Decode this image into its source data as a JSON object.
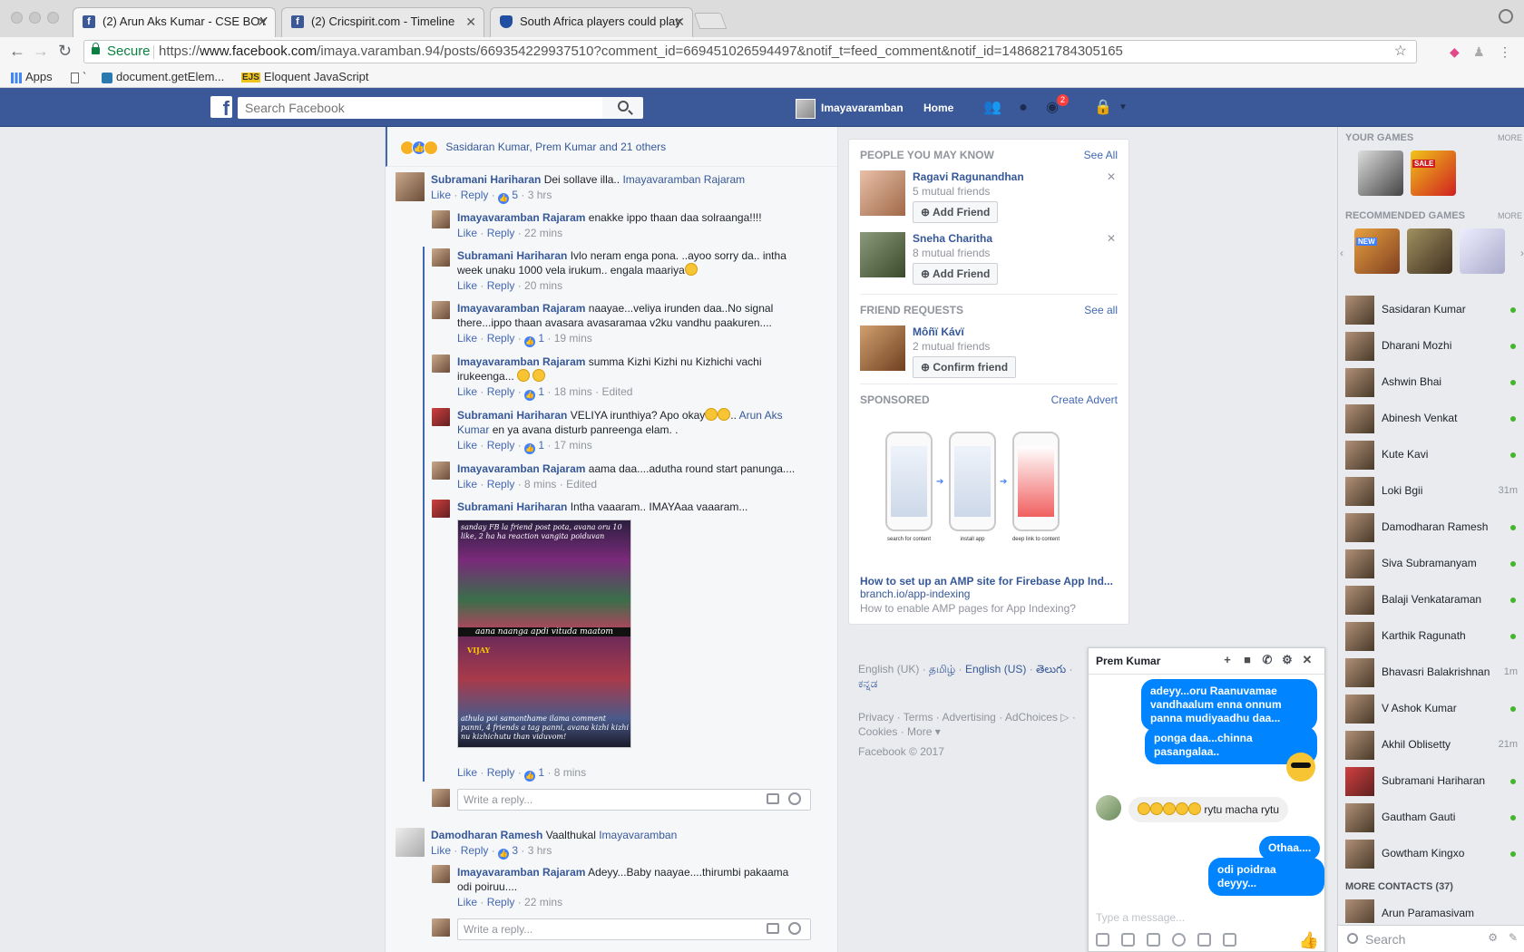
{
  "browser": {
    "tabs": [
      {
        "title": "(2) Arun Aks Kumar - CSE BOY",
        "icon": "facebook-icon"
      },
      {
        "title": "(2) Cricspirit.com - Timeline",
        "icon": "facebook-icon"
      },
      {
        "title": "South Africa players could play",
        "icon": "shield-icon"
      }
    ],
    "secure_label": "Secure",
    "url_scheme": "https://",
    "url_host": "www.facebook.com",
    "url_path": "/imaya.varamban.94/posts/669354229937510?comment_id=669451026594497&notif_t=feed_comment&notif_id=1486821784305165",
    "bookmarks": [
      "Apps",
      "`",
      "document.getElem...",
      "Eloquent JavaScript"
    ],
    "bookmark_ejs": "EJS"
  },
  "fb": {
    "logo": "f",
    "search_placeholder": "Search Facebook",
    "user_name": "Imayavaramban",
    "home_label": "Home",
    "notif_count": "2"
  },
  "post": {
    "reactions_text": "Sasidaran Kumar, Prem Kumar and 21 others",
    "comments": [
      {
        "name": "Subramani Hariharan",
        "text": "Dei sollave illa..",
        "tag": "Imayavaramban Rajaram",
        "like": "Like",
        "reply": "Reply",
        "likes": "5",
        "time": "3 hrs"
      },
      {
        "name": "Imayavaramban Rajaram",
        "text": "enakke ippo thaan daa solraanga!!!!",
        "like": "Like",
        "reply": "Reply",
        "time": "22 mins"
      },
      {
        "name": "Subramani Hariharan",
        "text": "Ivlo neram enga pona. ..ayoo sorry da.. intha",
        "text2": "week unaku 1000 vela irukum.. engala maariya",
        "like": "Like",
        "reply": "Reply",
        "time": "20 mins"
      },
      {
        "name": "Imayavaramban Rajaram",
        "text": "naayae...veliya irunden daa..No signal",
        "text2": "there...ippo thaan avasara avasaramaa v2ku vandhu paakuren....",
        "like": "Like",
        "reply": "Reply",
        "likes": "1",
        "time": "19 mins"
      },
      {
        "name": "Imayavaramban Rajaram",
        "text": "summa Kizhi Kizhi nu Kizhichi vachi",
        "text2": "irukeenga...",
        "like": "Like",
        "reply": "Reply",
        "likes": "1",
        "time": "18 mins",
        "edited": "Edited"
      },
      {
        "name": "Subramani Hariharan",
        "text": "VELIYA irunthiya? Apo okay",
        "tag": "Arun Aks",
        "tag2": "Kumar",
        "text2": "en ya avana disturb panreenga elam. .",
        "like": "Like",
        "reply": "Reply",
        "likes": "1",
        "time": "17 mins"
      },
      {
        "name": "Imayavaramban Rajaram",
        "text": "aama daa....adutha round start panunga....",
        "like": "Like",
        "reply": "Reply",
        "time": "8 mins",
        "edited": "Edited"
      },
      {
        "name": "Subramani Hariharan",
        "text": "Intha vaaaram.. IMAYAaa vaaaram...",
        "like": "Like",
        "reply": "Reply",
        "likes": "1",
        "time": "8 mins"
      }
    ],
    "meme": {
      "cap_top": "sanday FB la friend post pota, avana oru 10 like, 2 ha ha reaction vangita poiduvan",
      "cap_mid": "aana naanga apdi vituda maatom",
      "cap_bot": "athula poi samanthame ilama comment panni, 4 friends a tag panni, avana kizhi kizhi nu kizhichutu than viduvom!",
      "logo": "VIJAY"
    },
    "reply_placeholder": "Write a reply...",
    "comment2": {
      "name": "Damodharan Ramesh",
      "text": "Vaalthukal",
      "tag": "Imayavaramban",
      "like": "Like",
      "reply": "Reply",
      "likes": "3",
      "time": "3 hrs"
    },
    "reply2": {
      "name": "Imayavaramban Rajaram",
      "text": "Adeyy...Baby naayae....thirumbi pakaama",
      "text2": "odi poiruu....",
      "like": "Like",
      "reply": "Reply",
      "time": "22 mins"
    }
  },
  "right": {
    "pymk_title": "PEOPLE YOU MAY KNOW",
    "pymk_see_all": "See All",
    "pymk": [
      {
        "name": "Ragavi Ragunandhan",
        "mutual": "5 mutual friends",
        "button": "Add Friend"
      },
      {
        "name": "Sneha Charitha",
        "mutual": "8 mutual friends",
        "button": "Add Friend"
      }
    ],
    "fr_title": "FRIEND REQUESTS",
    "fr_see_all": "See all",
    "fr": {
      "name": "Môñï Kávï",
      "mutual": "2 mutual friends",
      "button": "Confirm friend"
    },
    "sponsored_title": "SPONSORED",
    "create_advert": "Create Advert",
    "phone_labels": [
      "search for content",
      "install app",
      "deep link to content"
    ],
    "ad_title": "How to set up an AMP site for Firebase App Ind...",
    "ad_url": "branch.io/app-indexing",
    "ad_desc": "How to enable AMP pages for App Indexing?",
    "languages": [
      "English (UK)",
      "தமிழ்",
      "English (US)",
      "తెలుగు",
      "ಕನ್ನಡ"
    ],
    "footer_links": [
      "Privacy",
      "Terms",
      "Advertising",
      "AdChoices",
      "Cookies",
      "More"
    ],
    "copyright": "Facebook © 2017"
  },
  "chat": {
    "name": "Prem Kumar",
    "messages_out": [
      "adeyy...oru Raanuvamae vandhaalum enna onnum panna mudiyaadhu daa...",
      "ponga daa...chinna pasangalaa.."
    ],
    "message_in": "rytu macha rytu",
    "messages_out2": [
      "Othaa....",
      "odi poidraa deyyy..."
    ],
    "input_placeholder": "Type a message..."
  },
  "sidebar": {
    "your_games": "YOUR GAMES",
    "recommended_games": "RECOMMENDED GAMES",
    "more": "MORE",
    "sale_tag": "SALE",
    "new_tag": "NEW",
    "contacts": [
      {
        "name": "Sasidaran Kumar",
        "ago": ""
      },
      {
        "name": "Dharani Mozhi",
        "ago": ""
      },
      {
        "name": "Ashwin Bhai",
        "ago": ""
      },
      {
        "name": "Abinesh Venkat",
        "ago": ""
      },
      {
        "name": "Kute Kavi",
        "ago": ""
      },
      {
        "name": "Loki Bgii",
        "ago": "31m"
      },
      {
        "name": "Damodharan Ramesh",
        "ago": ""
      },
      {
        "name": "Siva Subramanyam",
        "ago": ""
      },
      {
        "name": "Balaji Venkataraman",
        "ago": ""
      },
      {
        "name": "Karthik Ragunath",
        "ago": ""
      },
      {
        "name": "Bhavasri Balakrishnan",
        "ago": "1m"
      },
      {
        "name": "V Ashok Kumar",
        "ago": ""
      },
      {
        "name": "Akhil Oblisetty",
        "ago": "21m"
      },
      {
        "name": "Subramani Hariharan",
        "ago": ""
      },
      {
        "name": "Gautham Gauti",
        "ago": ""
      },
      {
        "name": "Gowtham Kingxo",
        "ago": ""
      }
    ],
    "more_contacts": "MORE CONTACTS (37)",
    "more_contact_1": "Arun Paramasivam",
    "search": "Search"
  }
}
